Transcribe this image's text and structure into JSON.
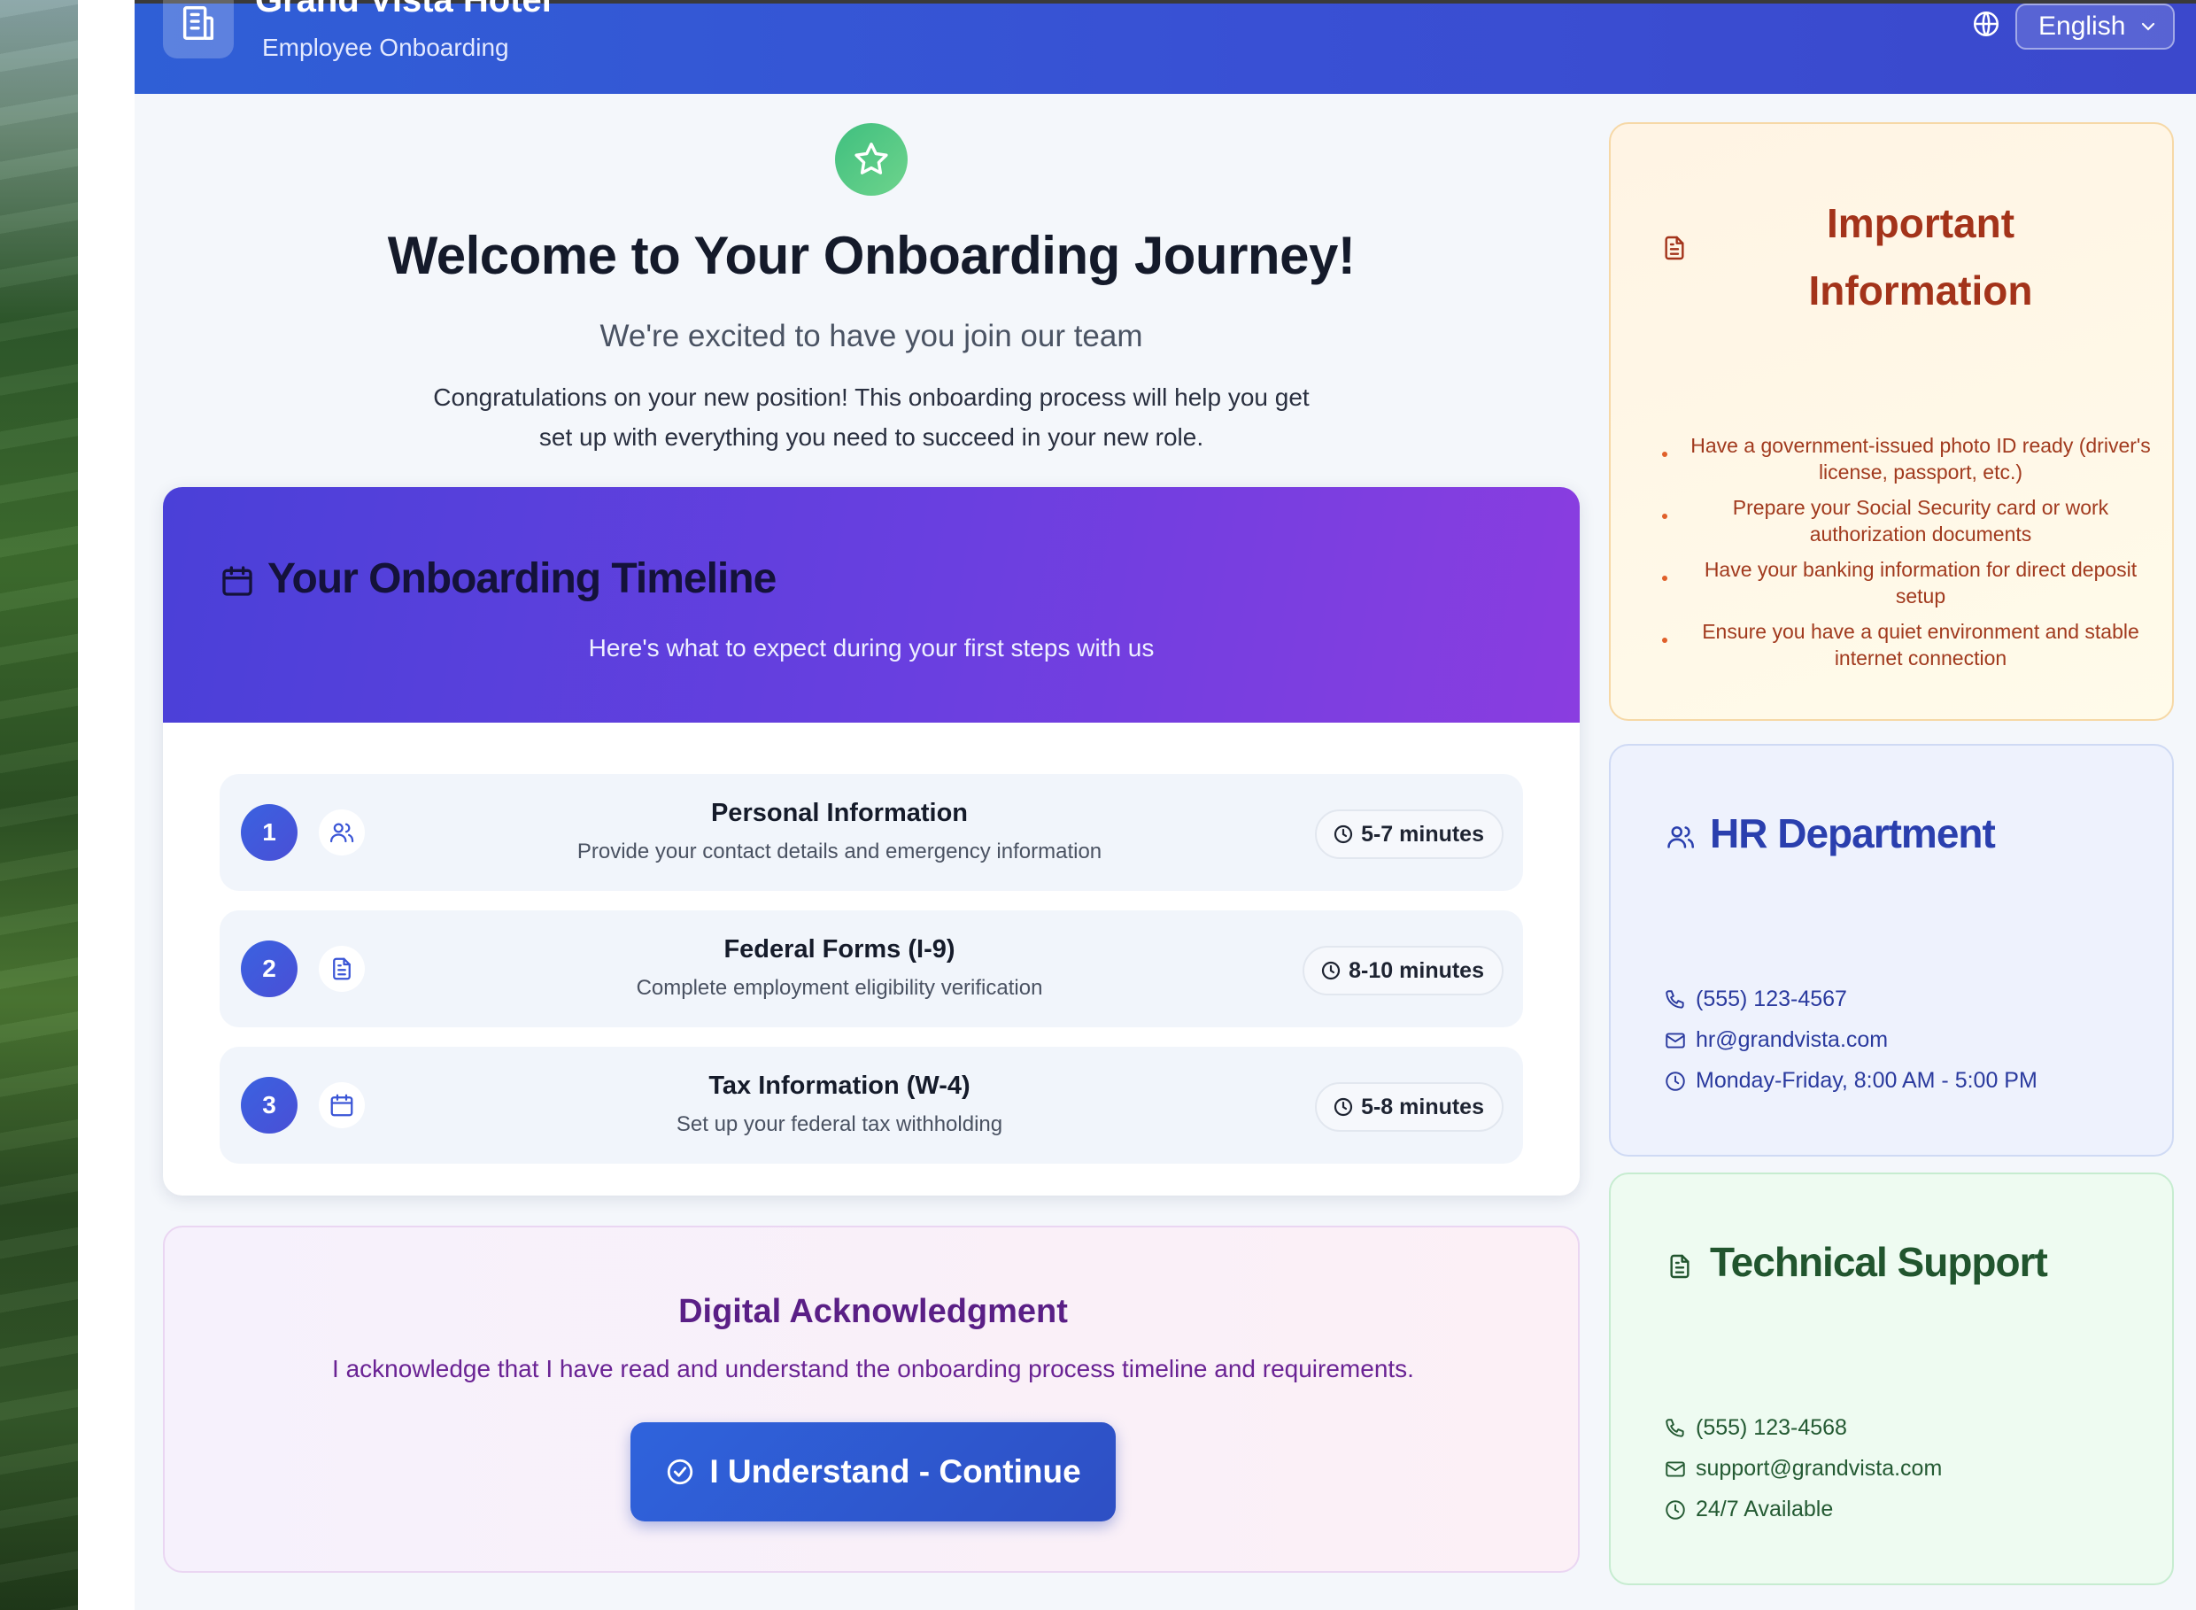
{
  "header": {
    "brand_name": "Grand Vista Hotel",
    "brand_sub": "Employee Onboarding",
    "language": "English"
  },
  "welcome": {
    "title": "Welcome to Your Onboarding Journey!",
    "subtitle": "We're excited to have you join our team",
    "body": "Congratulations on your new position! This onboarding process will help you get set up with everything you need to succeed in your new role."
  },
  "timeline": {
    "title": "Your Onboarding Timeline",
    "subtitle": "Here's what to expect during your first steps with us",
    "steps": [
      {
        "number": "1",
        "icon": "users-icon",
        "title": "Personal Information",
        "description": "Provide your contact details and emergency information",
        "duration": "5-7 minutes"
      },
      {
        "number": "2",
        "icon": "document-icon",
        "title": "Federal Forms (I-9)",
        "description": "Complete employment eligibility verification",
        "duration": "8-10 minutes"
      },
      {
        "number": "3",
        "icon": "calendar-icon",
        "title": "Tax Information (W-4)",
        "description": "Set up your federal tax withholding",
        "duration": "5-8 minutes"
      }
    ]
  },
  "acknowledgment": {
    "title": "Digital Acknowledgment",
    "text": "I acknowledge that I have read and understand the onboarding process timeline and requirements.",
    "button_label": "I Understand - Continue"
  },
  "important_info": {
    "title": "Important Information",
    "items": [
      "Have a government-issued photo ID ready (driver's license, passport, etc.)",
      "Prepare your Social Security card or work authorization documents",
      "Have your banking information for direct deposit setup",
      "Ensure you have a quiet environment and stable internet connection"
    ]
  },
  "hr": {
    "title": "HR Department",
    "phone": "(555) 123-4567",
    "email": "hr@grandvista.com",
    "hours": "Monday-Friday, 8:00 AM - 5:00 PM"
  },
  "tech_support": {
    "title": "Technical Support",
    "phone": "(555) 123-4568",
    "email": "support@grandvista.com",
    "hours": "24/7 Available"
  },
  "colors": {
    "header_blue": "#3950d4",
    "timeline_purple": "#6a3fe0",
    "button_blue": "#2f63dc",
    "info_orange": "#a3331a",
    "hr_blue": "#2a3fae",
    "tech_green": "#21552e",
    "success_green": "#3fbf7f"
  }
}
